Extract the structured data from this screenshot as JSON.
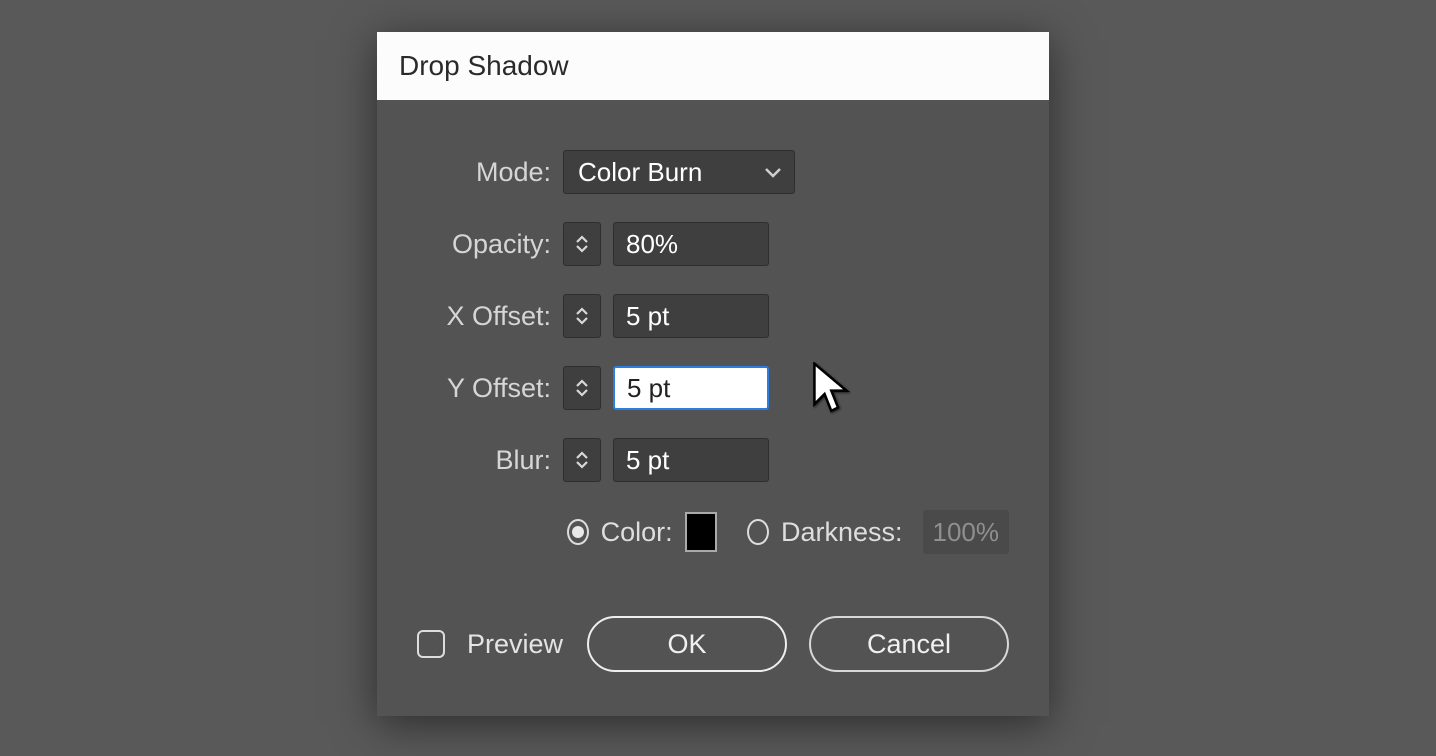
{
  "dialog": {
    "title": "Drop Shadow",
    "fields": {
      "mode": {
        "label": "Mode:",
        "value": "Color Burn"
      },
      "opacity": {
        "label": "Opacity:",
        "value": "80%"
      },
      "xoffset": {
        "label": "X Offset:",
        "value": "5 pt"
      },
      "yoffset": {
        "label": "Y Offset:",
        "value": "5 pt"
      },
      "blur": {
        "label": "Blur:",
        "value": "5 pt"
      }
    },
    "colorGroup": {
      "colorLabel": "Color:",
      "colorSwatch": "#000000",
      "darknessLabel": "Darkness:",
      "darknessValue": "100%",
      "selected": "color"
    },
    "preview": {
      "label": "Preview",
      "checked": false
    },
    "buttons": {
      "ok": "OK",
      "cancel": "Cancel"
    }
  }
}
